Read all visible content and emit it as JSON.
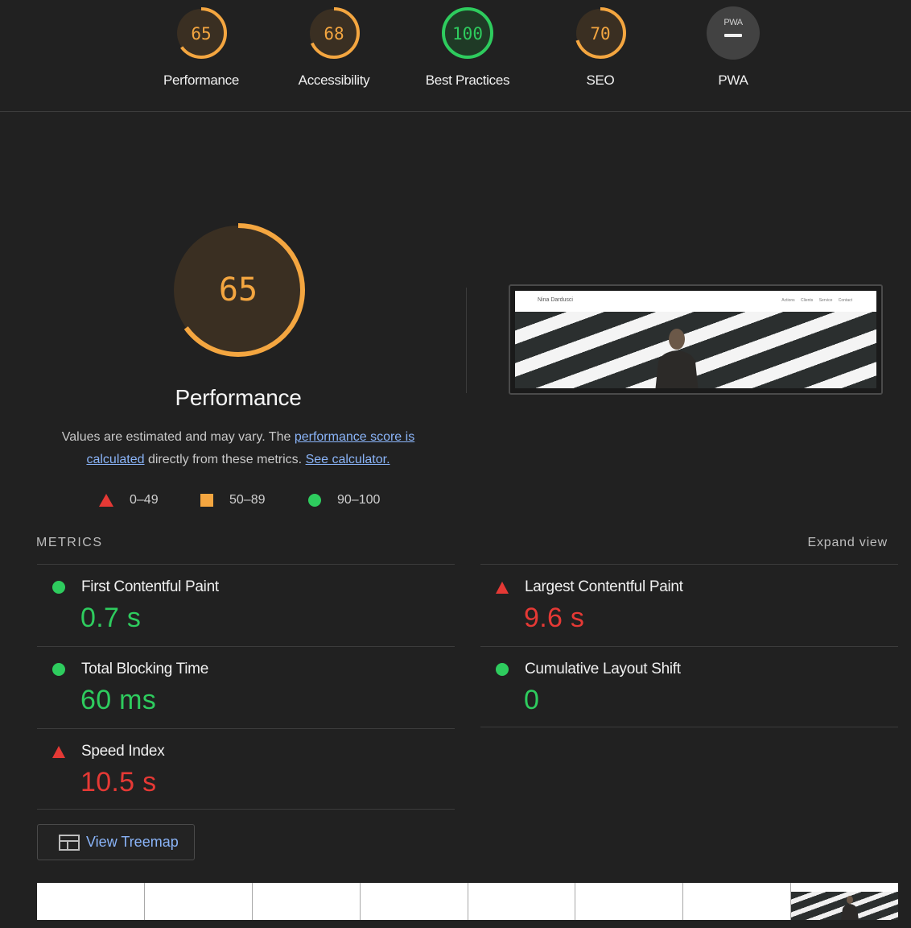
{
  "category_gauges": [
    {
      "score": "65",
      "label": "Performance",
      "color": "#f4a640",
      "fraction": 0.65
    },
    {
      "score": "68",
      "label": "Accessibility",
      "color": "#f4a640",
      "fraction": 0.68
    },
    {
      "score": "100",
      "label": "Best Practices",
      "color": "#2ecc5e",
      "fraction": 1.0
    },
    {
      "score": "70",
      "label": "SEO",
      "color": "#f4a640",
      "fraction": 0.7
    },
    {
      "score": "PWA",
      "label": "PWA",
      "color": "#9e9e9e",
      "fraction": 0
    }
  ],
  "performance": {
    "score": "65",
    "fraction": 0.65,
    "color": "#f4a640",
    "title": "Performance",
    "desc_prefix": "Values are estimated and may vary. The ",
    "desc_link1": "performance score is calculated",
    "desc_middle": " directly from these metrics. ",
    "desc_link2": "See calculator."
  },
  "legend": [
    {
      "range": "0–49",
      "shape": "triangle",
      "color": "#e53935"
    },
    {
      "range": "50–89",
      "shape": "square",
      "color": "#f4a640"
    },
    {
      "range": "90–100",
      "shape": "circle",
      "color": "#2ecc5e"
    }
  ],
  "screenshot": {
    "site_name": "Nina Dardusci",
    "nav": "Actions Clients Service Contact"
  },
  "metrics_section": {
    "heading": "METRICS",
    "expand": "Expand view"
  },
  "metrics": [
    {
      "label": "First Contentful Paint",
      "value": "0.7 s",
      "status": "good"
    },
    {
      "label": "Largest Contentful Paint",
      "value": "9.6 s",
      "status": "bad"
    },
    {
      "label": "Total Blocking Time",
      "value": "60 ms",
      "status": "good"
    },
    {
      "label": "Cumulative Layout Shift",
      "value": "0",
      "status": "good"
    },
    {
      "label": "Speed Index",
      "value": "10.5 s",
      "status": "bad"
    }
  ],
  "treemap_button": {
    "label": "View Treemap",
    "icon": "treemap-icon"
  },
  "colors": {
    "background": "#212121",
    "good": "#2ecc5e",
    "average": "#f4a640",
    "poor": "#e53935",
    "link": "#8ab4f8"
  }
}
